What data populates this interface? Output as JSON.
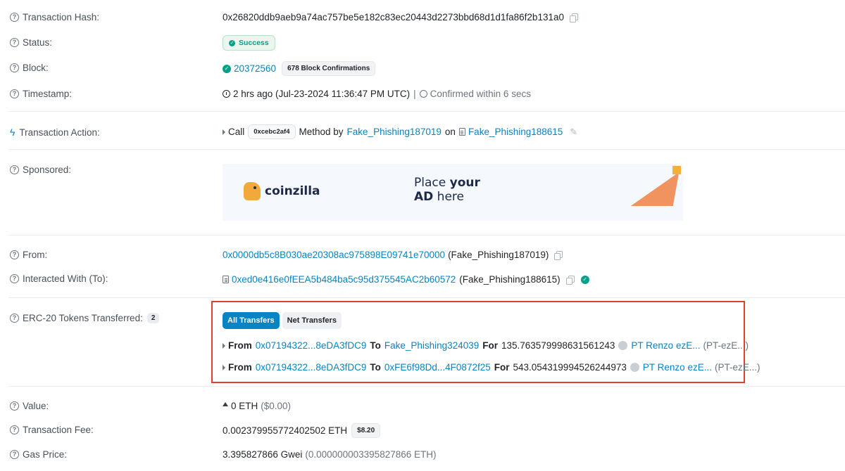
{
  "tx_hash": {
    "label": "Transaction Hash:",
    "value": "0x26820ddb9aeb9a74ac757be5e182c83ec20443d2273bbd68d1d1fa86f2b131a0"
  },
  "status": {
    "label": "Status:",
    "value": "Success"
  },
  "block": {
    "label": "Block:",
    "number": "20372560",
    "confirmations": "678 Block Confirmations"
  },
  "timestamp": {
    "label": "Timestamp:",
    "value": "2 hrs ago (Jul-23-2024 11:36:47 PM UTC)",
    "separator": "|",
    "confirmed": "Confirmed within 6 secs"
  },
  "action": {
    "label": "Transaction Action:",
    "call": "Call",
    "method_id": "0xcebc2af4",
    "method_by": "Method by",
    "caller": "Fake_Phishing187019",
    "on": "on",
    "target": "Fake_Phishing188615"
  },
  "sponsored": {
    "label": "Sponsored:",
    "ad_brand": "coinzilla",
    "ad_line1_a": "Place ",
    "ad_line1_b": "your",
    "ad_line2_a": "AD",
    "ad_line2_b": " here"
  },
  "from": {
    "label": "From:",
    "address": "0x0000db5c8B030ae20308ac975898E09741e70000",
    "name": "(Fake_Phishing187019)"
  },
  "to": {
    "label": "Interacted With (To):",
    "address": "0xed0e416e0fEEA5b484ba5c95d375545AC2b60572",
    "name": "(Fake_Phishing188615)"
  },
  "erc20": {
    "label": "ERC-20 Tokens Transferred:",
    "count": "2",
    "tab_all": "All Transfers",
    "tab_net": "Net Transfers",
    "transfers": [
      {
        "from_kw": "From",
        "from": "0x07194322...8eDA3fDC9",
        "to_kw": "To",
        "to": "Fake_Phishing324039",
        "for_kw": "For",
        "amount": "135.763579998631561243",
        "token": "PT Renzo ezE...",
        "symbol": "(PT-ezE...)"
      },
      {
        "from_kw": "From",
        "from": "0x07194322...8eDA3fDC9",
        "to_kw": "To",
        "to": "0xFE6f98Dd...4F0872f25",
        "for_kw": "For",
        "amount": "543.054319994526244973",
        "token": "PT Renzo ezE...",
        "symbol": "(PT-ezE...)"
      }
    ]
  },
  "value": {
    "label": "Value:",
    "eth": "0 ETH",
    "usd": "($0.00)"
  },
  "fee": {
    "label": "Transaction Fee:",
    "eth": "0.002379955772402502 ETH",
    "usd": "$8.20"
  },
  "gas_price": {
    "label": "Gas Price:",
    "gwei": "3.395827866 Gwei",
    "eth": "(0.000000003395827866 ETH)"
  },
  "colors": {
    "link": "#0784c3",
    "success": "#00a186",
    "highlight_border": "#e2402b"
  }
}
